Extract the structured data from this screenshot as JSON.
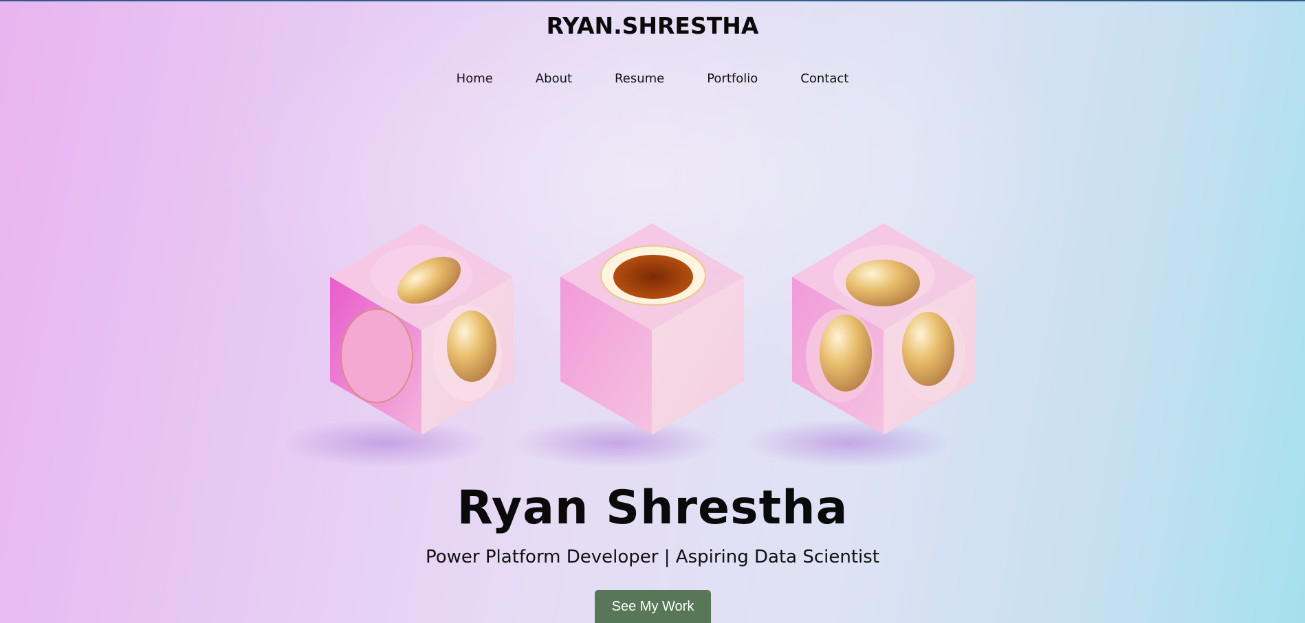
{
  "header": {
    "logo": "RYAN.SHRESTHA",
    "nav": [
      {
        "label": "Home"
      },
      {
        "label": "About"
      },
      {
        "label": "Resume"
      },
      {
        "label": "Portfolio"
      },
      {
        "label": "Contact"
      }
    ]
  },
  "hero": {
    "name": "Ryan Shrestha",
    "subtitle": "Power Platform Developer | Aspiring Data Scientist",
    "cta_label": "See My Work",
    "illustration": "three-pink-cubes-with-gold-spheres"
  },
  "colors": {
    "cta_background": "#587658",
    "cube_pink": "#f2a9d9",
    "gold": "#e4b865"
  }
}
